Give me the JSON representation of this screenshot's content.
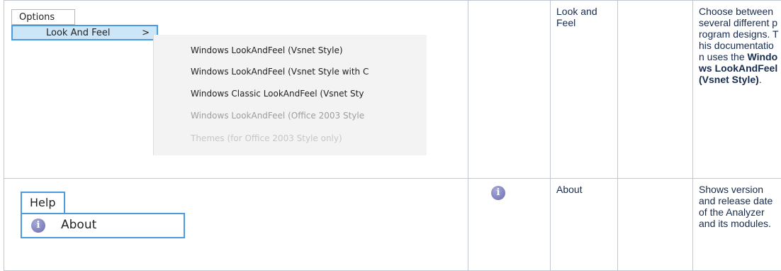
{
  "rows": [
    {
      "options_screenshot": {
        "menu_label": "Options",
        "item_label": "Look And Feel",
        "item_chevron": ">",
        "submenu": [
          "Windows LookAndFeel (Vsnet Style)",
          "Windows LookAndFeel (Vsnet Style with C",
          "Windows Classic LookAndFeel (Vsnet Sty",
          "Windows LookAndFeel (Office 2003 Style",
          "Themes (for Office 2003 Style only)"
        ]
      },
      "function": "Look and Feel",
      "desc_pre": "Choose between several different program designs. This documentation uses the ",
      "desc_bold": "Windows LookAndFeel (Vsnet Style)",
      "desc_post": "."
    },
    {
      "help_screenshot": {
        "menu_label": "Help",
        "item_icon": "info-icon",
        "item_label": "About"
      },
      "icon": "info-icon",
      "function": "About",
      "description": "Shows version and release date of the Analyzer and its modules."
    }
  ]
}
